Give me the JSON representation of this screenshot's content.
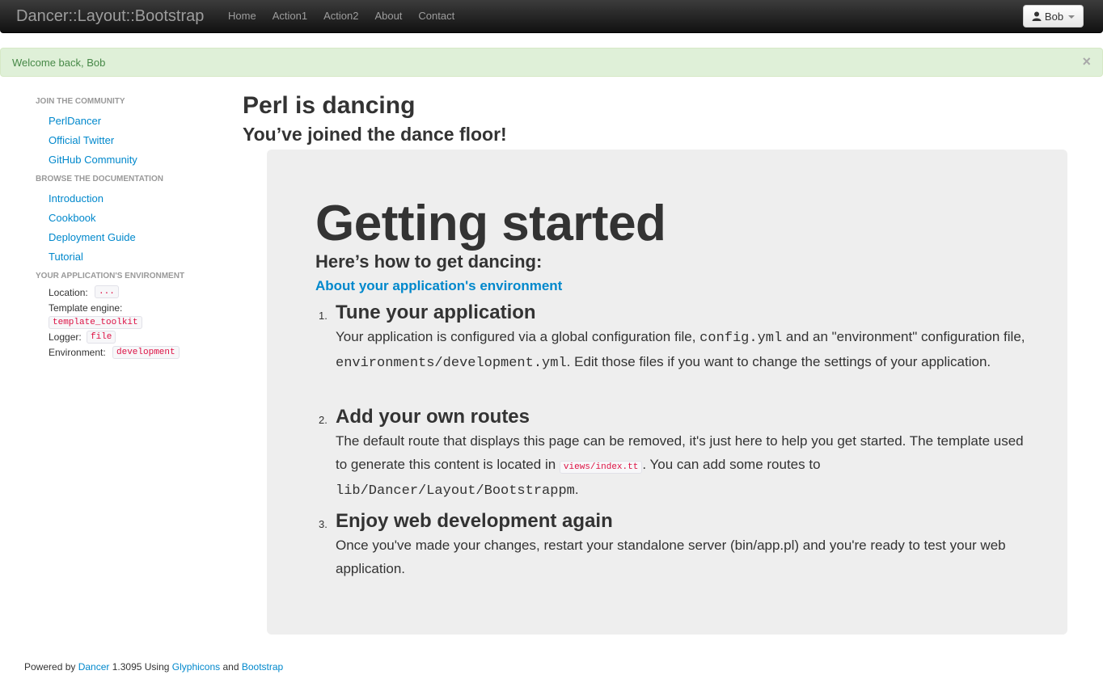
{
  "navbar": {
    "brand": "Dancer::Layout::Bootstrap",
    "items": [
      {
        "label": "Home"
      },
      {
        "label": "Action1"
      },
      {
        "label": "Action2"
      },
      {
        "label": "About"
      },
      {
        "label": "Contact"
      }
    ],
    "user": {
      "label": "Bob",
      "icon": "user-icon"
    }
  },
  "alert": {
    "message": "Welcome back, Bob",
    "close": "×",
    "color": "#468847",
    "background": "#dff0d8"
  },
  "sidebar": {
    "join_header": "JOIN THE COMMUNITY",
    "join_links": [
      {
        "label": "PerlDancer"
      },
      {
        "label": "Official Twitter"
      },
      {
        "label": "GitHub Community"
      }
    ],
    "docs_header": "BROWSE THE DOCUMENTATION",
    "docs_links": [
      {
        "label": "Introduction"
      },
      {
        "label": "Cookbook"
      },
      {
        "label": "Deployment Guide"
      },
      {
        "label": "Tutorial"
      }
    ],
    "env_header": "YOUR APPLICATION'S ENVIRONMENT",
    "env": {
      "location_label": "Location:",
      "location_value": "...",
      "template_label": "Template engine:",
      "template_value": "template_toolkit",
      "logger_label": "Logger:",
      "logger_value": "file",
      "environment_label": "Environment:",
      "environment_value": "development"
    }
  },
  "main": {
    "title": "Perl is dancing",
    "subtitle": "You’ve joined the dance floor!",
    "hero": {
      "title": "Getting started",
      "subtitle": "Here’s how to get dancing:",
      "env_link": "About your application's environment",
      "steps": [
        {
          "num": "1.",
          "title": "Tune your application",
          "text_a": "Your application is configured via a global configuration file, ",
          "code_a": "config.yml",
          "text_b": " and an \"environment\" configuration file, ",
          "code_b": "environments/development.yml",
          "text_c": ". Edit those files if you want to change the settings of your application."
        },
        {
          "num": "2.",
          "title": "Add your own routes",
          "text_a": "The default route that displays this page can be removed, it's just here to help you get started. The template used to generate this content is located in ",
          "code_a": "views/index.tt",
          "text_b": ". You can add some routes to ",
          "code_b": "lib/Dancer/Layout/Bootstrappm",
          "text_c": "."
        },
        {
          "num": "3.",
          "title": "Enjoy web development again",
          "text_a": "Once you've made your changes, restart your standalone server (bin/app.pl) and you're ready to test your web application."
        }
      ]
    }
  },
  "footer": {
    "powered_by": "Powered by ",
    "dancer_link": "Dancer",
    "version_text": " 1.3095 Using ",
    "glyphicons_link": "Glyphicons",
    "and_text": " and ",
    "bootstrap_link": "Bootstrap"
  },
  "colors": {
    "link": "#0088cc",
    "code": "#d14",
    "hero_bg": "#eeeeee",
    "navbar": "#222222"
  }
}
